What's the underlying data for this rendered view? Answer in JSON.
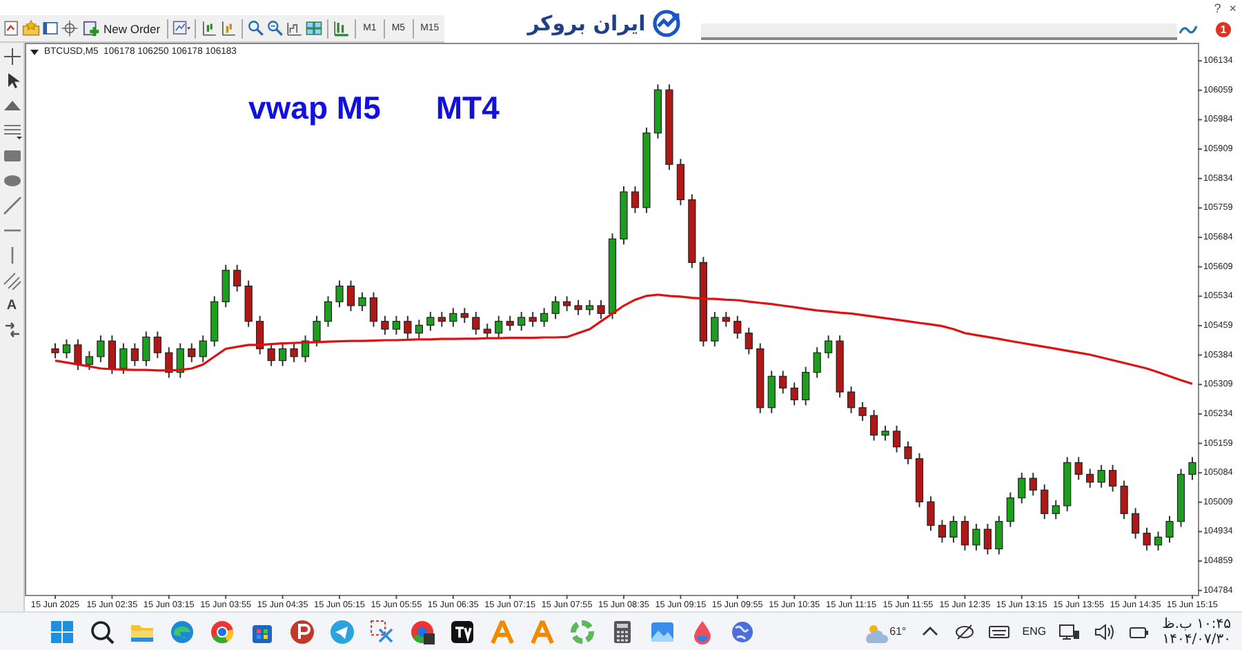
{
  "toolbar": {
    "new_order_button": "New Order",
    "timeframes": [
      {
        "label": "M1",
        "selected": false
      },
      {
        "label": "M5",
        "selected": false
      },
      {
        "label": "M15",
        "selected": false
      }
    ],
    "logo": "ایران بروکر",
    "window_controls": [
      "?",
      "×"
    ],
    "notification_count": "1"
  },
  "drawing_tools": {
    "text_tool": "A"
  },
  "chart": {
    "header": "BTCUSD,M5  106178 106250 106178 106183",
    "title_parts": [
      "vwap M5",
      "MT4"
    ],
    "chart_data": {
      "type": "candlestick",
      "ylim": [
        104773,
        106180
      ],
      "yticks": [
        {
          "value": 106134,
          "label": "106134"
        },
        {
          "value": 106059,
          "label": "106059"
        },
        {
          "value": 105984,
          "label": "105984"
        },
        {
          "value": 105909,
          "label": "105909"
        },
        {
          "value": 105834,
          "label": "105834"
        },
        {
          "value": 105759,
          "label": "105759"
        },
        {
          "value": 105684,
          "label": "105684"
        },
        {
          "value": 105609,
          "label": "105609"
        },
        {
          "value": 105534,
          "label": "105534"
        },
        {
          "value": 105459,
          "label": "105459"
        },
        {
          "value": 105384,
          "label": "105384"
        },
        {
          "value": 105309,
          "label": "105309"
        },
        {
          "value": 105234,
          "label": "105234"
        },
        {
          "value": 105159,
          "label": "105159"
        },
        {
          "value": 105084,
          "label": "105084"
        },
        {
          "value": 105009,
          "label": "105009"
        },
        {
          "value": 104934,
          "label": "104934"
        },
        {
          "value": 104859,
          "label": "104859"
        },
        {
          "value": 104784,
          "label": "104784"
        }
      ],
      "categories": [
        "15 Jun 2025",
        null,
        null,
        null,
        null,
        "15 Jun 02:35",
        null,
        null,
        null,
        null,
        "15 Jun 03:15",
        null,
        null,
        null,
        null,
        "15 Jun 03:55",
        null,
        null,
        null,
        null,
        "15 Jun 04:35",
        null,
        null,
        null,
        null,
        "15 Jun 05:15",
        null,
        null,
        null,
        null,
        "15 Jun 05:55",
        null,
        null,
        null,
        null,
        "15 Jun 06:35",
        null,
        null,
        null,
        null,
        "15 Jun 07:15",
        null,
        null,
        null,
        null,
        "15 Jun 07:55",
        null,
        null,
        null,
        null,
        "15 Jun 08:35",
        null,
        null,
        null,
        null,
        "15 Jun 09:15",
        null,
        null,
        null,
        null,
        "15 Jun 09:55",
        null,
        null,
        null,
        null,
        "15 Jun 10:35",
        null,
        null,
        null,
        null,
        "15 Jun 11:15",
        null,
        null,
        null,
        null,
        "15 Jun 11:55",
        null,
        null,
        null,
        null,
        "15 Jun 12:35",
        null,
        null,
        null,
        null,
        "15 Jun 13:15",
        null,
        null,
        null,
        null,
        "15 Jun 13:55",
        null,
        null,
        null,
        null,
        "15 Jun 14:35",
        null,
        null,
        null,
        null,
        "15 Jun 15:15"
      ],
      "ohlc": [
        [
          105400,
          105414,
          105376,
          105390
        ],
        [
          105390,
          105424,
          105376,
          105410
        ],
        [
          105410,
          105424,
          105346,
          105360
        ],
        [
          105360,
          105394,
          105346,
          105380
        ],
        [
          105380,
          105434,
          105366,
          105420
        ],
        [
          105420,
          105434,
          105336,
          105350
        ],
        [
          105350,
          105414,
          105336,
          105400
        ],
        [
          105400,
          105414,
          105356,
          105370
        ],
        [
          105370,
          105444,
          105356,
          105430
        ],
        [
          105430,
          105444,
          105376,
          105390
        ],
        [
          105390,
          105404,
          105326,
          105340
        ],
        [
          105340,
          105414,
          105326,
          105400
        ],
        [
          105400,
          105414,
          105366,
          105380
        ],
        [
          105380,
          105434,
          105366,
          105420
        ],
        [
          105420,
          105534,
          105406,
          105520
        ],
        [
          105520,
          105614,
          105506,
          105600
        ],
        [
          105600,
          105614,
          105546,
          105560
        ],
        [
          105560,
          105574,
          105456,
          105470
        ],
        [
          105470,
          105484,
          105386,
          105400
        ],
        [
          105400,
          105414,
          105356,
          105370
        ],
        [
          105370,
          105414,
          105356,
          105400
        ],
        [
          105400,
          105414,
          105366,
          105380
        ],
        [
          105380,
          105434,
          105366,
          105420
        ],
        [
          105420,
          105484,
          105406,
          105470
        ],
        [
          105470,
          105534,
          105456,
          105520
        ],
        [
          105520,
          105574,
          105506,
          105560
        ],
        [
          105560,
          105574,
          105496,
          105510
        ],
        [
          105510,
          105544,
          105496,
          105530
        ],
        [
          105530,
          105544,
          105456,
          105470
        ],
        [
          105470,
          105484,
          105436,
          105450
        ],
        [
          105450,
          105484,
          105436,
          105470
        ],
        [
          105470,
          105484,
          105426,
          105440
        ],
        [
          105440,
          105474,
          105426,
          105460
        ],
        [
          105460,
          105494,
          105446,
          105480
        ],
        [
          105480,
          105494,
          105456,
          105470
        ],
        [
          105470,
          105504,
          105456,
          105490
        ],
        [
          105490,
          105504,
          105466,
          105480
        ],
        [
          105480,
          105494,
          105436,
          105450
        ],
        [
          105450,
          105464,
          105426,
          105440
        ],
        [
          105440,
          105484,
          105426,
          105470
        ],
        [
          105470,
          105484,
          105446,
          105460
        ],
        [
          105460,
          105494,
          105446,
          105480
        ],
        [
          105480,
          105494,
          105456,
          105470
        ],
        [
          105470,
          105504,
          105456,
          105490
        ],
        [
          105490,
          105534,
          105476,
          105520
        ],
        [
          105520,
          105534,
          105496,
          105510
        ],
        [
          105510,
          105524,
          105486,
          105500
        ],
        [
          105500,
          105524,
          105486,
          105510
        ],
        [
          105510,
          105524,
          105476,
          105490
        ],
        [
          105490,
          105694,
          105476,
          105680
        ],
        [
          105680,
          105814,
          105666,
          105800
        ],
        [
          105800,
          105814,
          105746,
          105760
        ],
        [
          105760,
          105964,
          105746,
          105950
        ],
        [
          105950,
          106074,
          105936,
          106060
        ],
        [
          106060,
          106074,
          105856,
          105870
        ],
        [
          105870,
          105884,
          105766,
          105780
        ],
        [
          105780,
          105794,
          105606,
          105620
        ],
        [
          105620,
          105634,
          105406,
          105420
        ],
        [
          105420,
          105494,
          105406,
          105480
        ],
        [
          105480,
          105494,
          105456,
          105470
        ],
        [
          105470,
          105484,
          105426,
          105440
        ],
        [
          105440,
          105454,
          105386,
          105400
        ],
        [
          105400,
          105414,
          105236,
          105250
        ],
        [
          105250,
          105344,
          105236,
          105330
        ],
        [
          105330,
          105344,
          105286,
          105300
        ],
        [
          105300,
          105314,
          105256,
          105270
        ],
        [
          105270,
          105354,
          105256,
          105340
        ],
        [
          105340,
          105404,
          105326,
          105390
        ],
        [
          105390,
          105434,
          105376,
          105420
        ],
        [
          105420,
          105434,
          105276,
          105290
        ],
        [
          105290,
          105304,
          105236,
          105250
        ],
        [
          105250,
          105264,
          105216,
          105230
        ],
        [
          105230,
          105244,
          105166,
          105180
        ],
        [
          105180,
          105204,
          105166,
          105190
        ],
        [
          105190,
          105204,
          105136,
          105150
        ],
        [
          105150,
          105164,
          105106,
          105120
        ],
        [
          105120,
          105134,
          104996,
          105010
        ],
        [
          105010,
          105024,
          104936,
          104950
        ],
        [
          104950,
          104964,
          104906,
          104920
        ],
        [
          104920,
          104974,
          104906,
          104960
        ],
        [
          104960,
          104974,
          104886,
          104900
        ],
        [
          104900,
          104954,
          104886,
          104940
        ],
        [
          104940,
          104954,
          104876,
          104890
        ],
        [
          104890,
          104974,
          104876,
          104960
        ],
        [
          104960,
          105034,
          104946,
          105020
        ],
        [
          105020,
          105084,
          105006,
          105070
        ],
        [
          105070,
          105084,
          105026,
          105040
        ],
        [
          105040,
          105054,
          104966,
          104980
        ],
        [
          104980,
          105014,
          104966,
          105000
        ],
        [
          105000,
          105124,
          104986,
          105110
        ],
        [
          105110,
          105124,
          105066,
          105080
        ],
        [
          105080,
          105094,
          105046,
          105060
        ],
        [
          105060,
          105104,
          105046,
          105090
        ],
        [
          105090,
          105104,
          105036,
          105050
        ],
        [
          105050,
          105064,
          104966,
          104980
        ],
        [
          104980,
          104994,
          104916,
          104930
        ],
        [
          104930,
          104944,
          104886,
          104900
        ],
        [
          104900,
          104934,
          104886,
          104920
        ],
        [
          104920,
          104974,
          104906,
          104960
        ],
        [
          104960,
          105094,
          104946,
          105080
        ],
        [
          105080,
          105124,
          105066,
          105110
        ]
      ],
      "series": [
        {
          "type": "line",
          "color": "#e01010",
          "values": [
            105370,
            105365,
            105360,
            105355,
            105350,
            105348,
            105347,
            105346,
            105346,
            105345,
            105345,
            105346,
            105350,
            105360,
            105380,
            105400,
            105405,
            105410,
            105410,
            105412,
            105414,
            105415,
            105416,
            105417,
            105418,
            105419,
            105420,
            105420,
            105421,
            105422,
            105422,
            105423,
            105424,
            105424,
            105425,
            105425,
            105426,
            105426,
            105427,
            105427,
            105428,
            105428,
            105428,
            105429,
            105429,
            105430,
            105440,
            105450,
            105470,
            105490,
            105510,
            105525,
            105535,
            105538,
            105535,
            105533,
            105530,
            105528,
            105527,
            105525,
            105524,
            105520,
            105517,
            105514,
            105510,
            105506,
            105502,
            105498,
            105495,
            105492,
            105490,
            105486,
            105482,
            105478,
            105474,
            105470,
            105466,
            105462,
            105458,
            105450,
            105440,
            105435,
            105430,
            105425,
            105420,
            105415,
            105410,
            105405,
            105400,
            105395,
            105390,
            105385,
            105378,
            105371,
            105364,
            105357,
            105350,
            105340,
            105330,
            105320,
            105311
          ]
        }
      ]
    }
  },
  "taskbar": {
    "weather": "61°",
    "language": "ENG",
    "time": "۱۰:۴۵ ب.ظ",
    "date": "۱۴۰۴/۰۷/۳۰"
  }
}
